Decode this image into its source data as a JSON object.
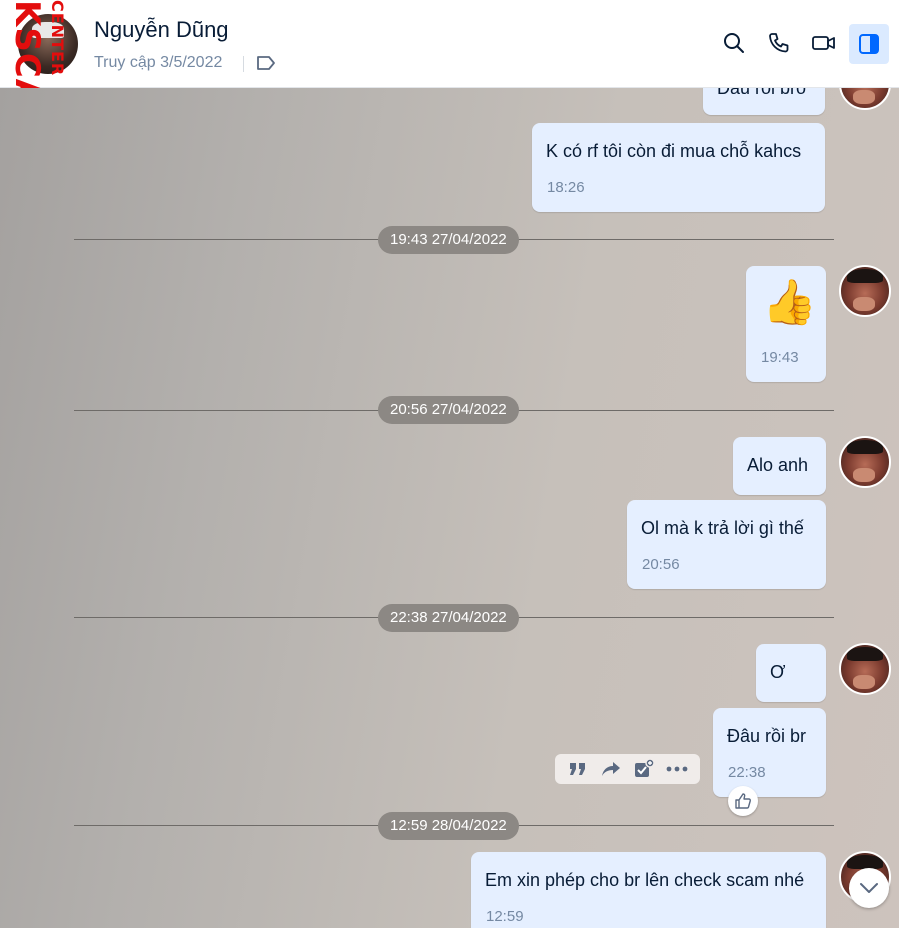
{
  "watermark": {
    "main": "KSCAM.INFO",
    "small": "CENTER"
  },
  "header": {
    "contact_name": "Nguyễn Dũng",
    "last_seen": "Truy cập 3/5/2022",
    "icons": [
      "avatar",
      "tag-icon",
      "search-icon",
      "phone-icon",
      "video-call-icon",
      "sidebar-toggle-icon"
    ]
  },
  "messages": {
    "m0": {
      "text": "Đâu rồi bro"
    },
    "m1": {
      "text": "K có rf tôi còn đi mua chỗ kahcs",
      "time": "18:26"
    },
    "d1": "19:43 27/04/2022",
    "m2": {
      "text": "👍",
      "time": "19:43"
    },
    "d2": "20:56 27/04/2022",
    "m3": {
      "text": "Alo anh"
    },
    "m4": {
      "text": "Ol mà k trả lời gì thế",
      "time": "20:56"
    },
    "d3": "22:38 27/04/2022",
    "m5": {
      "text": "Ơ"
    },
    "m6": {
      "text": "Đâu rồi br",
      "time": "22:38"
    },
    "d4": "12:59 28/04/2022",
    "m7": {
      "text": "Em xin phép cho br lên check scam nhé",
      "time": "12:59"
    }
  },
  "message_actions": [
    "quote-icon",
    "forward-icon",
    "add-task-icon",
    "more-icon"
  ],
  "colors": {
    "bubble": "#e5efff",
    "accent": "#0068ff",
    "time_text": "#7589a3",
    "watermark": "#e30d0d"
  }
}
